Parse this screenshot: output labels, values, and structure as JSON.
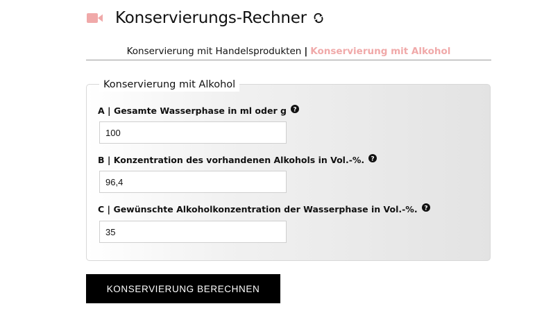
{
  "header": {
    "title": "Konservierungs-Rechner",
    "camera_icon": "video-camera-icon",
    "refresh_icon": "refresh-icon",
    "accent_color": "#f0a9a9"
  },
  "tabs": {
    "items": [
      {
        "label": "Konservierung mit Handelsprodukten",
        "active": false
      },
      {
        "label": "Konservierung mit Alkohol",
        "active": true
      }
    ],
    "separator": "|"
  },
  "form": {
    "legend": "Konservierung mit Alkohol",
    "fields": [
      {
        "label": "A | Gesamte Wasserphase in ml oder g",
        "value": "100"
      },
      {
        "label": "B | Konzentration des vorhandenen Alkohols in Vol.-%.",
        "value": "96,4"
      },
      {
        "label": "C | Gewünschte Alkoholkonzentration der Wasserphase in Vol.-%.",
        "value": "35"
      }
    ],
    "help_icon": "question-circle-icon"
  },
  "actions": {
    "calculate_label": "KONSERVIERUNG BERECHNEN"
  }
}
